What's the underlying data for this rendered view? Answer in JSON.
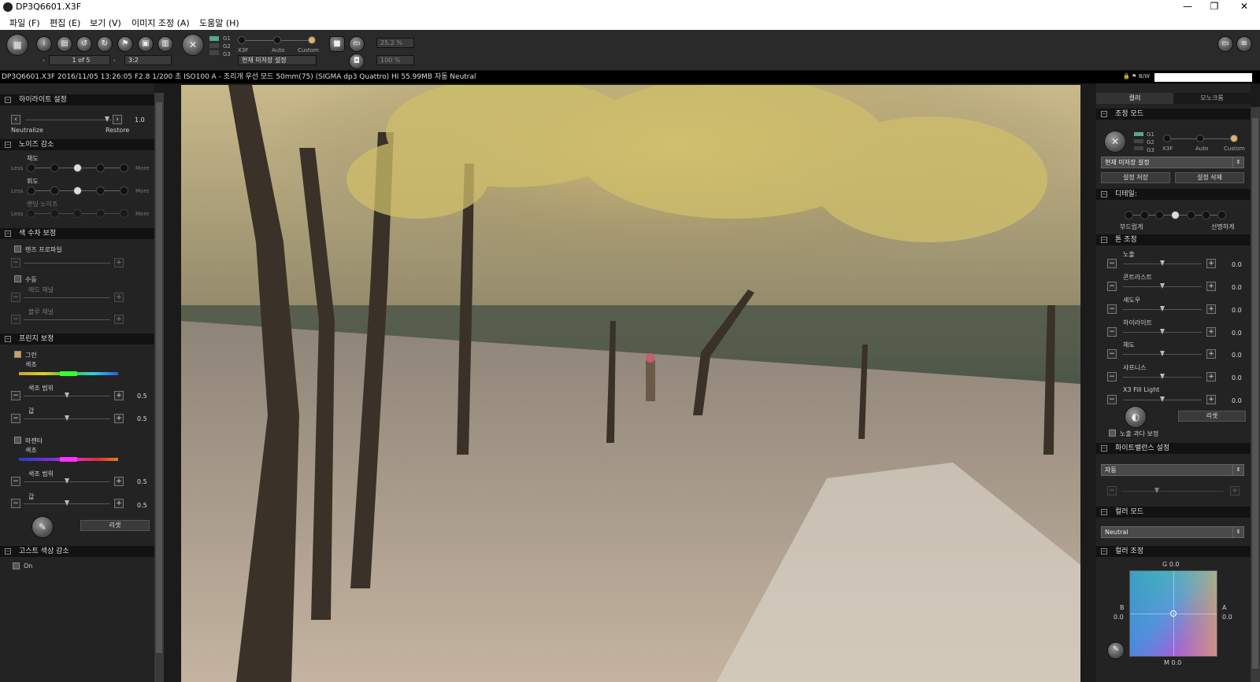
{
  "window": {
    "title": "DP3Q6601.X3F",
    "controls": [
      "—",
      "❐",
      "✕"
    ]
  },
  "menu": [
    "파일 (F)",
    "편집 (E)",
    "보기 (V)",
    "이미지 조정 (A)",
    "도움말 (H)"
  ],
  "toolbar": {
    "page": "1 of 5",
    "ratio": "3:2",
    "modes": {
      "g1": "G1",
      "g2": "G2",
      "g3": "G3",
      "x3f": "X3F",
      "auto": "Auto",
      "custom": "Custom"
    },
    "preset": "현재 미저장 설정",
    "zoom1": "25.2 %",
    "zoom2": "100 %"
  },
  "info": "DP3Q6601.X3F 2016/11/05 13:26:05 F2.8 1/200 초 ISO100 A - 조리개 우선 모드 50mm(75) (SIGMA dp3 Quattro) HI 55.99MB 자동 Neutral",
  "bw_label": "B/W",
  "left": {
    "highlight": {
      "title": "하이라이트 설정",
      "neutralize": "Neutralize",
      "restore": "Restore",
      "value": "1.0"
    },
    "noise": {
      "title": "노이즈 감소",
      "chroma": "채도",
      "luma": "휘도",
      "banding": "밴딩 노이즈",
      "less": "Less",
      "more": "More"
    },
    "aberration": {
      "title": "색 수차 보정",
      "lens_profile": "렌즈 프로파일",
      "manual": "수동",
      "red": "레드 채널",
      "blue": "블루 채널"
    },
    "fringe": {
      "title": "프린지 보정",
      "green": "그린",
      "hue": "색조",
      "hue_range": "색조 범위",
      "amount": "값",
      "green_range": "0.5",
      "green_amount": "0.5",
      "magenta": "마젠타",
      "magenta_range": "0.5",
      "magenta_amount": "0.5",
      "reset": "리셋"
    },
    "ghost": {
      "title": "고스트 색상 감소",
      "on": "On"
    }
  },
  "right": {
    "tabs": [
      "컬러",
      "모노크롬"
    ],
    "adjust_mode": {
      "title": "조정 모드",
      "g1": "G1",
      "g2": "G2",
      "g3": "G3",
      "x3f": "X3F",
      "auto": "Auto",
      "custom": "Custom",
      "preset": "현재 미저장 설정",
      "save": "설정 저장",
      "delete": "설정 삭제"
    },
    "detail": {
      "title": "디테일:",
      "soft": "부드럽게",
      "sharp": "선명하게"
    },
    "tone": {
      "title": "톤 조정",
      "items": [
        {
          "label": "노출",
          "value": "0.0"
        },
        {
          "label": "콘트라스트",
          "value": "0.0"
        },
        {
          "label": "섀도우",
          "value": "0.0"
        },
        {
          "label": "하이라이트",
          "value": "0.0"
        },
        {
          "label": "채도",
          "value": "0.0"
        },
        {
          "label": "샤프니스",
          "value": "0.0"
        },
        {
          "label": "X3 Fill Light",
          "value": "0.0"
        }
      ],
      "reset": "리셋",
      "overexposure": "노출 과다 보정"
    },
    "wb": {
      "title": "화이트밸런스 설정",
      "value": "자동"
    },
    "color_mode": {
      "title": "컬러 모드",
      "value": "Neutral"
    },
    "color_adjust": {
      "title": "컬러 조정",
      "g": "G 0.0",
      "b": "B",
      "b_val": "0.0",
      "a": "A",
      "a_val": "0.0",
      "m": "M 0.0"
    }
  }
}
